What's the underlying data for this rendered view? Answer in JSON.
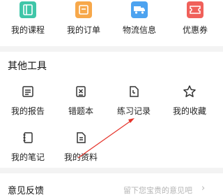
{
  "quick_menu": [
    {
      "label": "我的课程",
      "icon": "course-book-icon",
      "color": "#3fc6a8"
    },
    {
      "label": "我的订单",
      "icon": "order-clipboard-icon",
      "color": "#f7a84a"
    },
    {
      "label": "物流信息",
      "icon": "delivery-truck-icon",
      "color": "#4da3f0"
    },
    {
      "label": "优惠券",
      "icon": "coupon-ticket-icon",
      "color": "#f0605a"
    }
  ],
  "tools": {
    "title": "其他工具",
    "items": [
      {
        "label": "我的报告",
        "icon": "report-icon"
      },
      {
        "label": "错题本",
        "icon": "wrong-question-book-icon"
      },
      {
        "label": "练习记录",
        "icon": "practice-record-icon"
      },
      {
        "label": "我的收藏",
        "icon": "star-icon"
      },
      {
        "label": "我的笔记",
        "icon": "notebook-icon"
      },
      {
        "label": "我的资料",
        "icon": "document-icon"
      }
    ]
  },
  "feedback": {
    "title": "意见反馈",
    "hint": "留下您宝贵的意见吧",
    "chevron": "›"
  },
  "colors": {
    "annotation_arrow": "#e5332a",
    "icon_stroke": "#333333",
    "background": "#f3f3f3"
  }
}
